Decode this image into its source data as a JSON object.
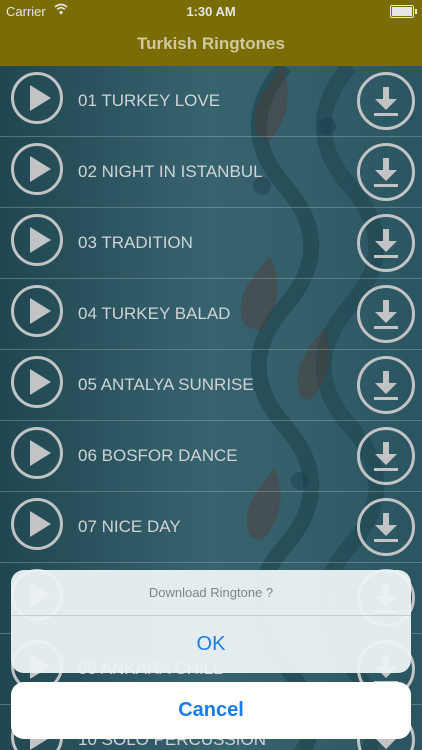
{
  "status_bar": {
    "carrier": "Carrier",
    "time": "1:30 AM"
  },
  "nav": {
    "title": "Turkish Ringtones"
  },
  "ringtones": [
    {
      "title": "01 TURKEY LOVE"
    },
    {
      "title": "02 NIGHT IN ISTANBUL"
    },
    {
      "title": "03 TRADITION"
    },
    {
      "title": "04 TURKEY BALAD"
    },
    {
      "title": "05 ANTALYA SUNRISE"
    },
    {
      "title": "06 BOSFOR DANCE"
    },
    {
      "title": "07 NICE DAY"
    },
    {
      "title": ""
    },
    {
      "title": "09 ANKARA CHILL"
    },
    {
      "title": "10 SOLO PERCUSSION"
    }
  ],
  "action_sheet": {
    "message": "Download Ringtone ?",
    "ok_label": "OK",
    "cancel_label": "Cancel"
  },
  "colors": {
    "bar": "#8a7a06",
    "accent": "#1a7ce8",
    "list_bg": "#2d5f6b"
  }
}
